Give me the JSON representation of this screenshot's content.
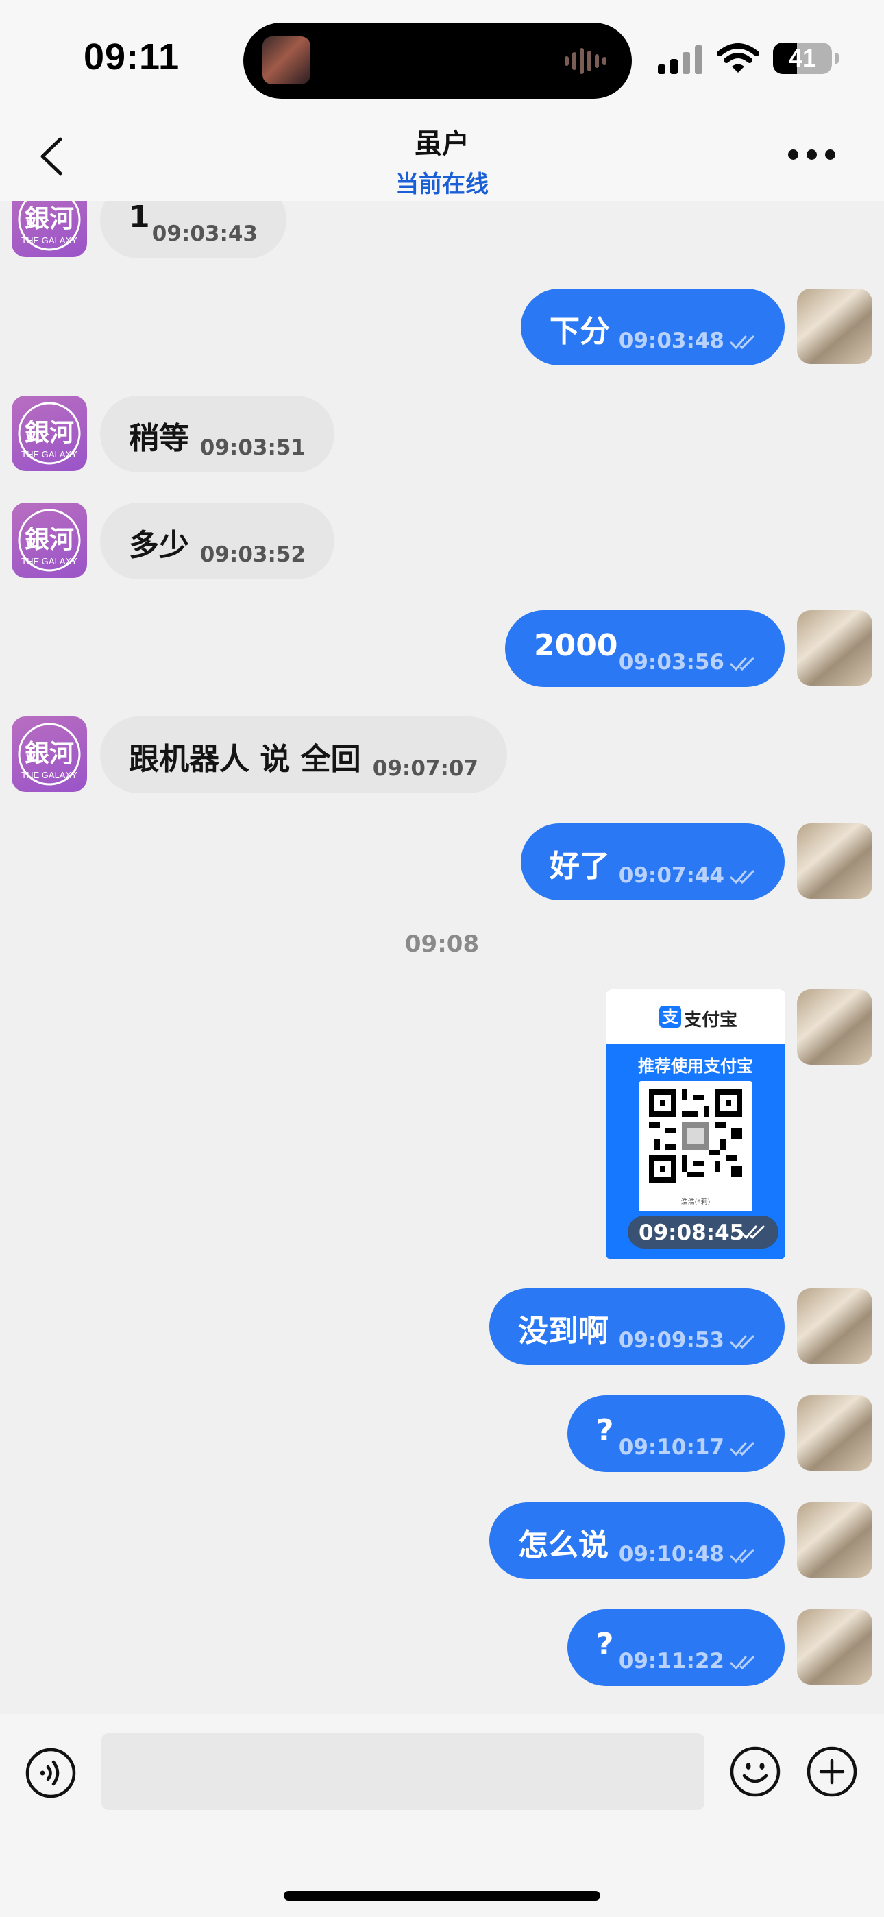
{
  "status_bar": {
    "time": "09:11",
    "battery": "41",
    "battery_level": 0.41
  },
  "header": {
    "title": "虽户",
    "subtitle": "当前在线"
  },
  "messages": [
    {
      "text": "1",
      "time": "09:03:43"
    },
    {
      "text": "下分",
      "time": "09:03:48"
    },
    {
      "text": "稍等",
      "time": "09:03:51"
    },
    {
      "text": "多少",
      "time": "09:03:52"
    },
    {
      "text": "2000",
      "time": "09:03:56"
    },
    {
      "text": "跟机器人 说 全回",
      "time": "09:07:07"
    },
    {
      "text": "好了",
      "time": "09:07:44"
    },
    {
      "text": "没到啊",
      "time": "09:09:53"
    },
    {
      "text": "?",
      "time": "09:10:17"
    },
    {
      "text": "怎么说",
      "time": "09:10:48"
    },
    {
      "text": "?",
      "time": "09:11:22"
    }
  ],
  "date_separator": "09:08",
  "avatar_in_text": {
    "mark": "銀河",
    "sub": "THE GALAXY"
  },
  "payment_card": {
    "brand": "支付宝",
    "logo_char": "支",
    "caption": "推荐使用支付宝",
    "payee": "浩浩(*莉)",
    "time": "09:08:45"
  },
  "colors": {
    "accent": "#2a78f4",
    "incoming_bubble": "#e6e6e6",
    "online": "#1b5fd6",
    "alipay": "#1677ff"
  },
  "icons": [
    "back-chevron-icon",
    "more-icon",
    "voice-icon",
    "emoji-icon",
    "plus-icon",
    "double-check-icon",
    "wifi-icon",
    "signal-icon"
  ]
}
